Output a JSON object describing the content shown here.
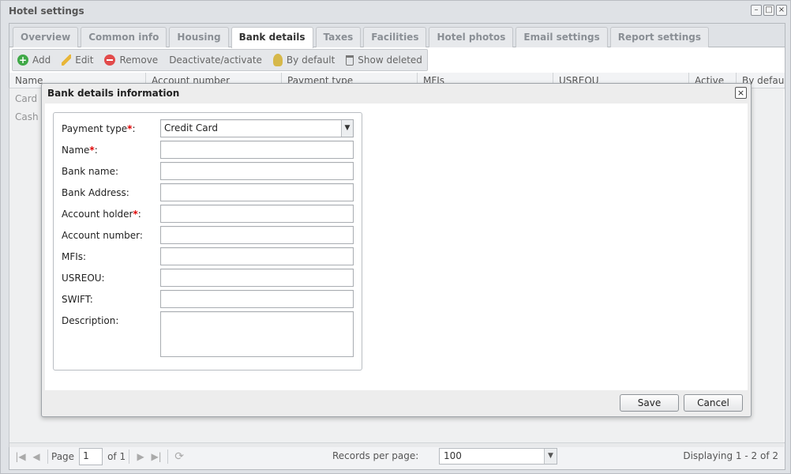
{
  "window": {
    "title": "Hotel settings",
    "buttons": [
      "–",
      "□",
      "×"
    ]
  },
  "tabs": [
    {
      "label": "Overview"
    },
    {
      "label": "Common info"
    },
    {
      "label": "Housing"
    },
    {
      "label": "Bank details",
      "active": true
    },
    {
      "label": "Taxes"
    },
    {
      "label": "Facilities"
    },
    {
      "label": "Hotel photos"
    },
    {
      "label": "Email settings"
    },
    {
      "label": "Report settings"
    }
  ],
  "toolbar": {
    "add": "Add",
    "edit": "Edit",
    "remove": "Remove",
    "deactivate": "Deactivate/activate",
    "by_default": "By default",
    "show_deleted": "Show deleted"
  },
  "grid": {
    "columns": [
      "Name",
      "Account number",
      "Payment type",
      "MFIs",
      "USREOU",
      "Active",
      "By default"
    ],
    "rows": [
      [
        "Card"
      ],
      [
        "Cash"
      ]
    ]
  },
  "pager": {
    "page_label": "Page",
    "page_value": "1",
    "of_label": "of 1",
    "records_label": "Records per page:",
    "records_value": "100",
    "displaying": "Displaying 1 - 2 of 2"
  },
  "dialog": {
    "title": "Bank details information",
    "close": "×",
    "fields": {
      "payment_type": {
        "label": "Payment type",
        "required": "*",
        "value": "Credit Card"
      },
      "name": {
        "label": "Name",
        "required": "*",
        "value": ""
      },
      "bank_name": {
        "label": "Bank name:",
        "value": ""
      },
      "bank_address": {
        "label": "Bank Address:",
        "value": ""
      },
      "account_holder": {
        "label": "Account holder",
        "required": "*",
        "value": ""
      },
      "account_number": {
        "label": "Account number:",
        "value": ""
      },
      "mfis": {
        "label": "MFIs:",
        "value": ""
      },
      "usreou": {
        "label": "USREOU:",
        "value": ""
      },
      "swift": {
        "label": "SWIFT:",
        "value": ""
      },
      "description": {
        "label": "Description:",
        "value": ""
      }
    },
    "save": "Save",
    "cancel": "Cancel"
  },
  "colors": {
    "required": "#e00000",
    "window_bg": "#dfe2e6"
  }
}
